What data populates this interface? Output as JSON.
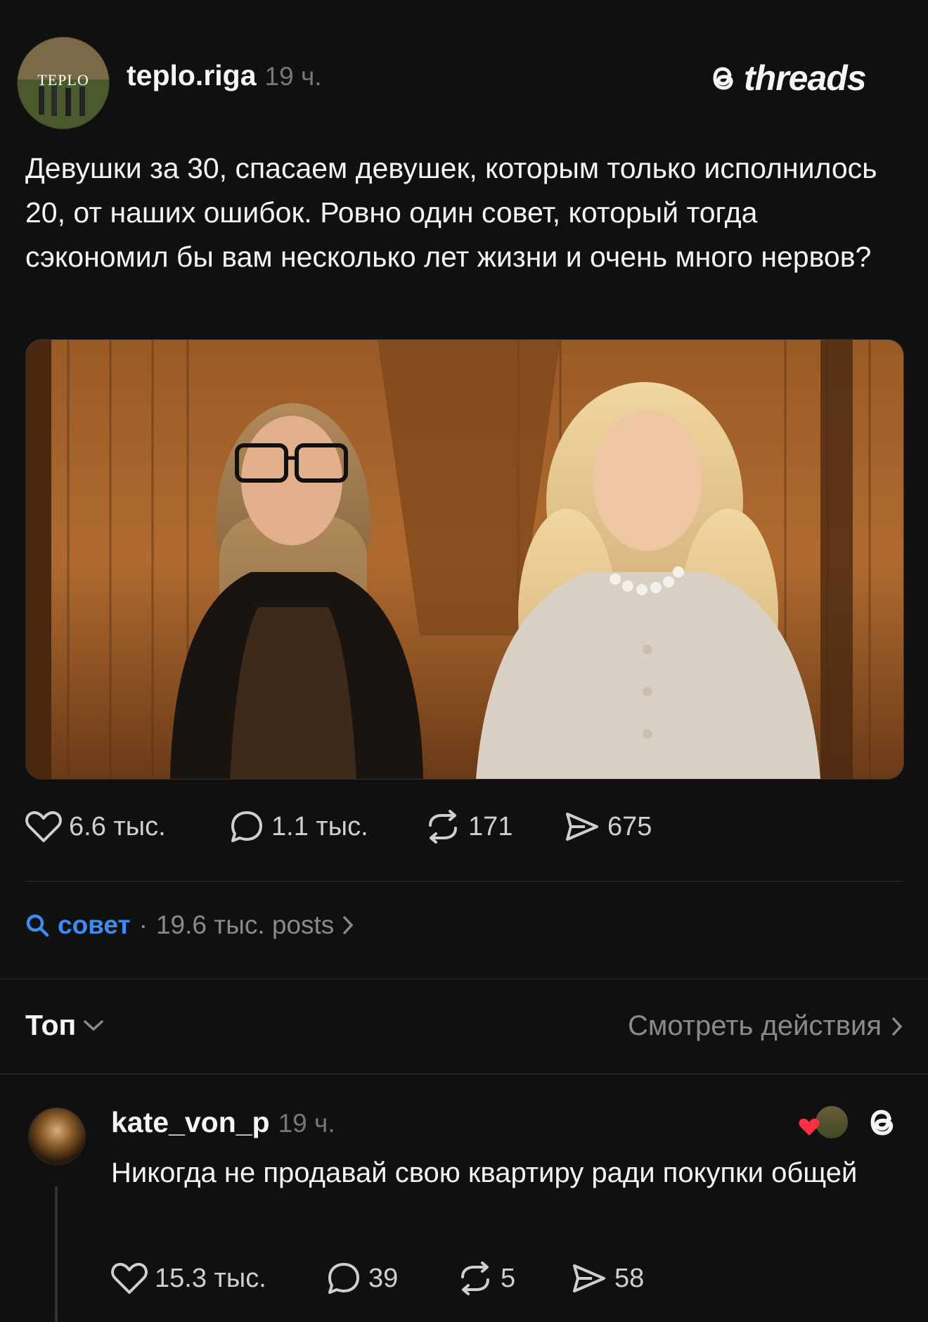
{
  "post": {
    "avatar_text": "TEPLO",
    "username": "teplo.riga",
    "time": "19 ч.",
    "brand": "threads",
    "text": "Девушки за 30, спасаем девушек, которым только исполнилось 20, от наших ошибок. Ровно один совет, который тогда сэкономил бы вам несколько лет жизни и очень много нервов?",
    "image_alt": "two women standing in a wooden room",
    "likes": "6.6 тыс.",
    "comments": "1.1 тыс.",
    "reposts": "171",
    "shares": "675"
  },
  "tag": {
    "name": "совет",
    "separator": "·",
    "meta": "19.6 тыс. posts"
  },
  "sort": {
    "label": "Топ",
    "view_activity": "Смотреть действия"
  },
  "reply": {
    "username": "kate_von_p",
    "time": "19 ч.",
    "text": "Никогда не продавай свою квартиру ради покупки общей",
    "likes": "15.3 тыс.",
    "comments": "39",
    "reposts": "5",
    "shares": "58"
  },
  "colors": {
    "background": "#101010",
    "text": "#f3f5f7",
    "muted": "#8a8a8a",
    "accent": "#3b8df2",
    "heart": "#ff3040"
  }
}
